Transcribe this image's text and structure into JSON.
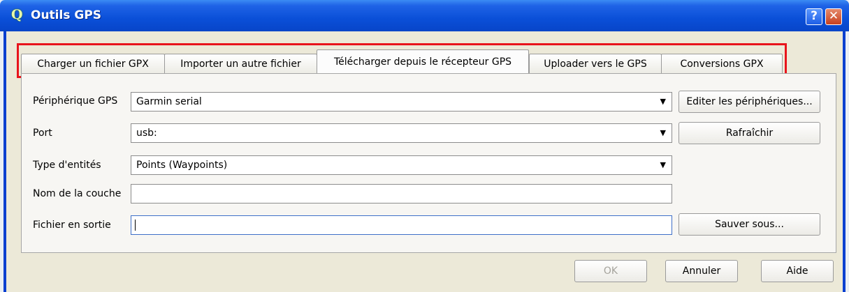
{
  "window": {
    "title": "Outils GPS",
    "app_icon": "Q"
  },
  "titlebar_buttons": {
    "help": "?",
    "close": "✕"
  },
  "tabs": [
    {
      "label": "Charger un fichier GPX"
    },
    {
      "label": "Importer un autre fichier"
    },
    {
      "label": "Télécharger depuis le récepteur GPS"
    },
    {
      "label": "Uploader vers le GPS"
    },
    {
      "label": "Conversions GPX"
    }
  ],
  "form": {
    "device": {
      "label": "Périphérique GPS",
      "value": "Garmin serial",
      "edit_button": "Editer les périphériques..."
    },
    "port": {
      "label": "Port",
      "value": "usb:",
      "refresh_button": "Rafraîchir"
    },
    "feature_type": {
      "label": "Type d'entités",
      "value": "Points (Waypoints)"
    },
    "layer_name": {
      "label": "Nom de la couche",
      "value": ""
    },
    "output_file": {
      "label": "Fichier en sortie",
      "value": "",
      "save_button": "Sauver sous..."
    }
  },
  "footer": {
    "ok": "OK",
    "cancel": "Annuler",
    "help": "Aide"
  }
}
